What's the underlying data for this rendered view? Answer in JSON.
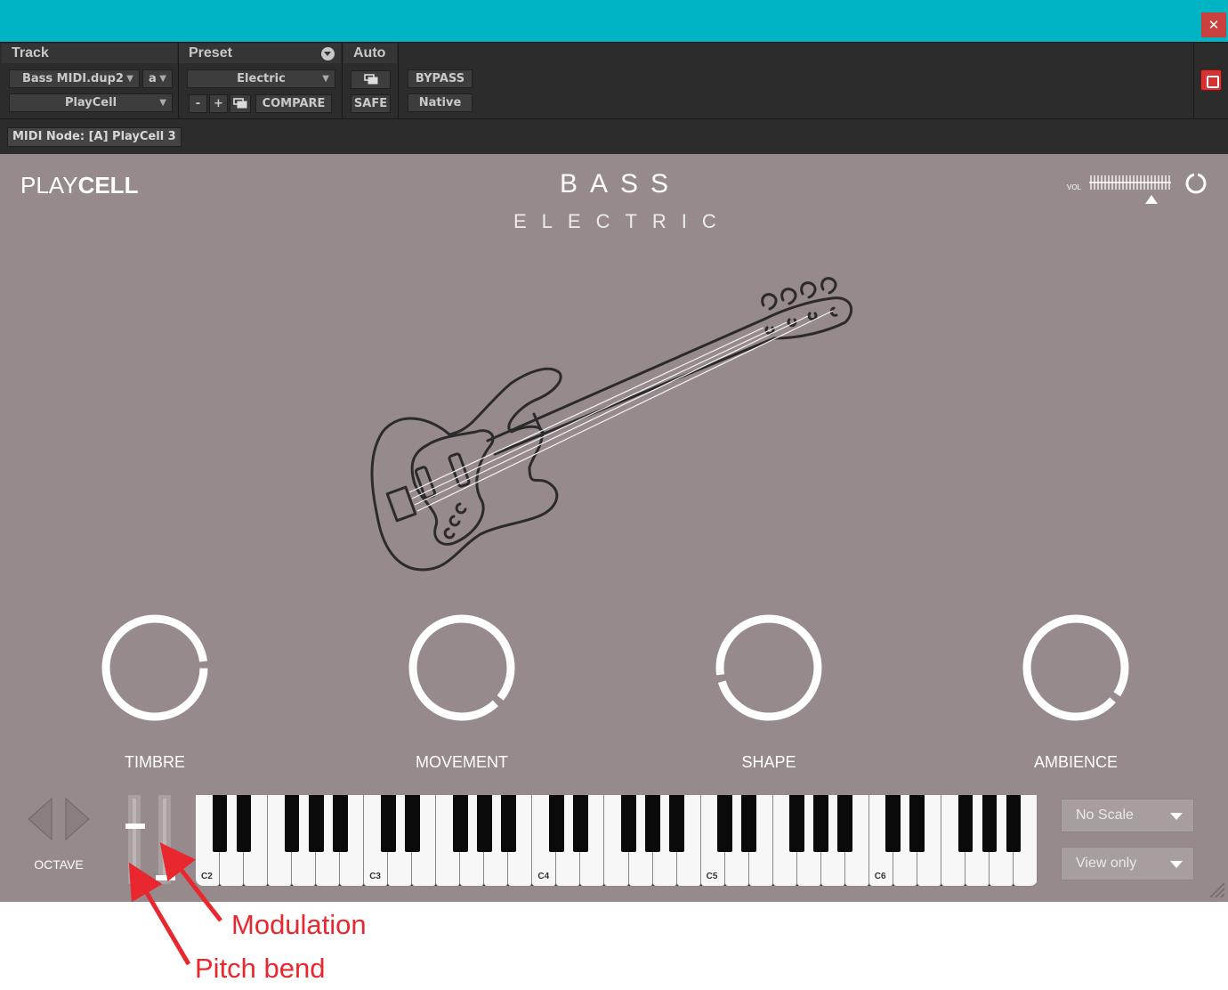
{
  "window": {
    "close_glyph": "✕",
    "title_color": "#00b4c4"
  },
  "header": {
    "track_label": "Track",
    "preset_label": "Preset",
    "auto_label": "Auto",
    "track_select": "Bass MIDI.dup2",
    "channel_select": "a",
    "insert_select": "PlayCell",
    "preset_select": "Electric",
    "minus_label": "-",
    "plus_label": "+",
    "compare_label": "COMPARE",
    "safe_label": "SAFE",
    "bypass_label": "BYPASS",
    "native_label": "Native",
    "midi_node": "MIDI Node: [A] PlayCell 3"
  },
  "plugin": {
    "logo_part1": "PLAY",
    "logo_part2": "CELL",
    "instrument_title": "BASS",
    "instrument_subtitle": "ELECTRIC",
    "vol_label": "VOL",
    "knobs": [
      {
        "label": "TIMBRE",
        "value": 0.82
      },
      {
        "label": "MOVEMENT",
        "value": 0.99
      },
      {
        "label": "SHAPE",
        "value": 0.12
      },
      {
        "label": "AMBIENCE",
        "value": 0.97
      }
    ],
    "octave_label": "OCTAVE",
    "pitch_bend_value": 0.5,
    "modulation_value": 0.0,
    "keyboard": {
      "octave_labels": [
        "C2",
        "C3",
        "C4",
        "C5",
        "C6"
      ]
    },
    "scale_dropdown": "No Scale",
    "mode_dropdown": "View only",
    "bg_color": "#978a8d"
  },
  "annotations": {
    "modulation": "Modulation",
    "pitch_bend": "Pitch bend",
    "color": "#e8282e"
  }
}
